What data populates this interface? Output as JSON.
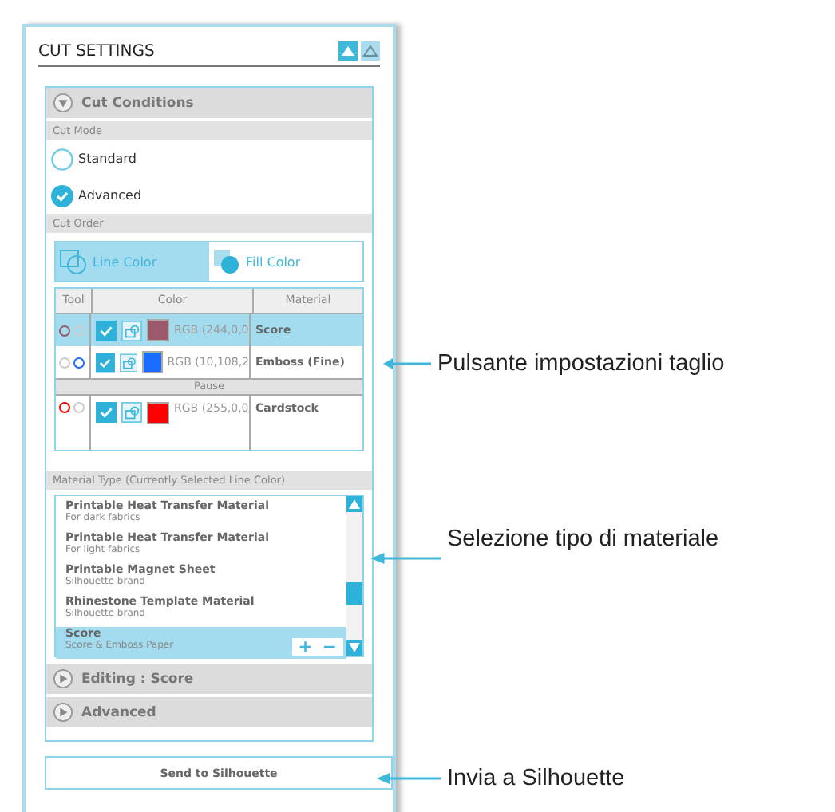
{
  "panel": {
    "title": "CUT SETTINGS"
  },
  "sections": [
    {
      "title": "Cut Conditions",
      "expanded": true
    },
    {
      "title": "Editing : Score",
      "expanded": false
    },
    {
      "title": "Advanced",
      "expanded": false
    }
  ],
  "cut_mode": {
    "label": "Cut Mode",
    "options": [
      {
        "label": "Standard",
        "selected": false
      },
      {
        "label": "Advanced",
        "selected": true
      }
    ]
  },
  "cut_order": {
    "label": "Cut Order",
    "tabs": [
      {
        "label": "Line Color",
        "selected": true
      },
      {
        "label": "Fill Color",
        "selected": false
      }
    ]
  },
  "table": {
    "columns": [
      "Tool",
      "Color",
      "Material"
    ],
    "rows": [
      {
        "kind": "color",
        "selected": true,
        "tools": [
          {
            "selected": true
          },
          {
            "selected": false
          }
        ],
        "checked": true,
        "color": "#9a5a6c",
        "rgb": "RGB (244,0,0",
        "material": "Score"
      },
      {
        "kind": "color",
        "selected": false,
        "tools": [
          {
            "selected": false
          },
          {
            "selected": true
          }
        ],
        "checked": true,
        "color": "#1a6cff",
        "rgb": "RGB (10,108,2",
        "material": "Emboss (Fine)"
      },
      {
        "kind": "pause",
        "label": "Pause"
      },
      {
        "kind": "color",
        "selected": false,
        "tools": [
          {
            "selected": true
          },
          {
            "selected": false
          }
        ],
        "checked": true,
        "color": "#ff0000",
        "rgb": "RGB (255,0,0",
        "material": "Cardstock"
      }
    ]
  },
  "material_type": {
    "label": "Material Type (Currently Selected Line Color)",
    "items": [
      {
        "name": "Printable Heat Transfer Material",
        "note": "For dark fabrics",
        "selected": false
      },
      {
        "name": "Printable Heat Transfer Material",
        "note": "For light fabrics",
        "selected": false
      },
      {
        "name": "Printable Magnet Sheet",
        "note": "Silhouette brand",
        "selected": false
      },
      {
        "name": "Rhinestone Template Material",
        "note": "Silhouette brand",
        "selected": false
      },
      {
        "name": "Score",
        "note": "Score & Emboss Paper",
        "selected": true
      }
    ],
    "add": "+",
    "remove": "−"
  },
  "send_button": "Send to Silhouette",
  "annotations": [
    "Pulsante impostazioni taglio",
    "Selezione tipo di materiale",
    "Invia a Silhouette"
  ]
}
